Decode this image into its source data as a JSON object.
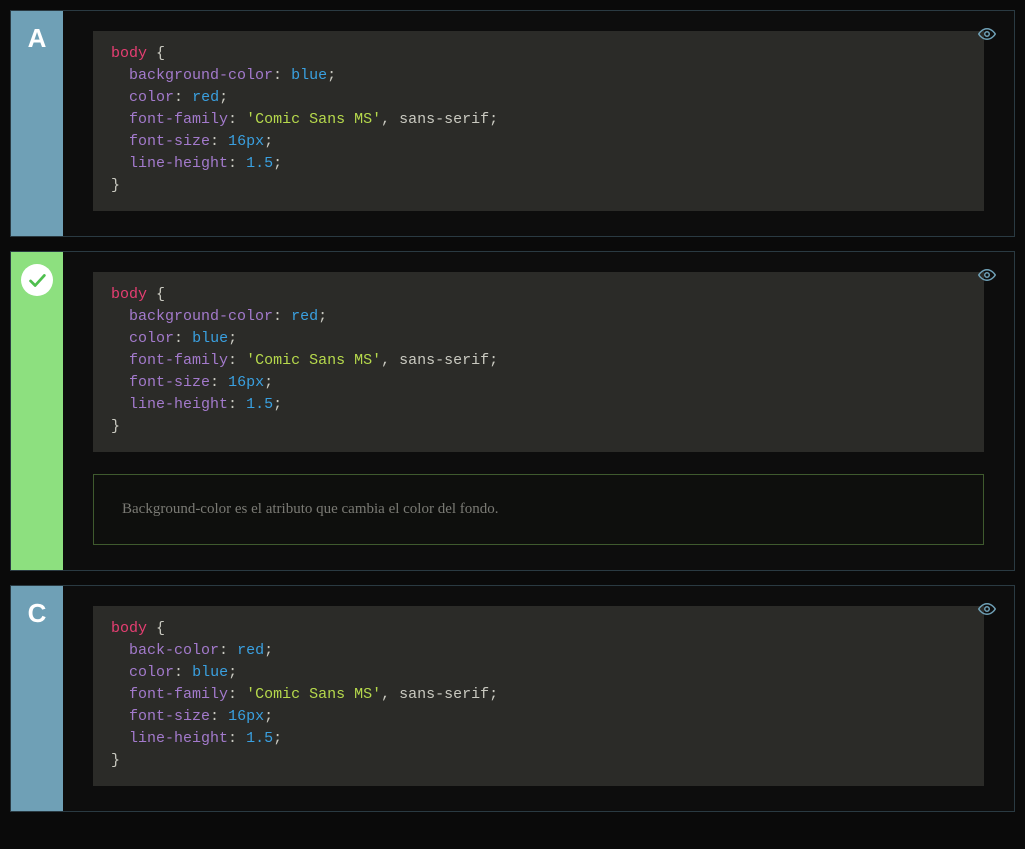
{
  "options": [
    {
      "label": "A",
      "labelClass": "label-blue",
      "correct": false,
      "code": {
        "selector": "body",
        "rules": [
          {
            "prop": "background-color",
            "value_kw": "blue"
          },
          {
            "prop": "color",
            "value_kw": "red"
          },
          {
            "prop": "font-family",
            "value_str": "'Comic Sans MS'",
            "tail_plain": ", sans-serif"
          },
          {
            "prop": "font-size",
            "value_num": "16",
            "unit_kw": "px"
          },
          {
            "prop": "line-height",
            "value_num": "1.5"
          }
        ]
      }
    },
    {
      "label": "",
      "labelClass": "label-green",
      "correct": true,
      "explanation": "Background-color es el atributo que cambia el color del fondo.",
      "code": {
        "selector": "body",
        "rules": [
          {
            "prop": "background-color",
            "value_kw": "red"
          },
          {
            "prop": "color",
            "value_kw": "blue"
          },
          {
            "prop": "font-family",
            "value_str": "'Comic Sans MS'",
            "tail_plain": ", sans-serif"
          },
          {
            "prop": "font-size",
            "value_num": "16",
            "unit_kw": "px"
          },
          {
            "prop": "line-height",
            "value_num": "1.5"
          }
        ]
      }
    },
    {
      "label": "C",
      "labelClass": "label-blue",
      "correct": false,
      "code": {
        "selector": "body",
        "rules": [
          {
            "prop": "back-color",
            "value_kw": "red"
          },
          {
            "prop": "color",
            "value_kw": "blue"
          },
          {
            "prop": "font-family",
            "value_str": "'Comic Sans MS'",
            "tail_plain": ", sans-serif"
          },
          {
            "prop": "font-size",
            "value_num": "16",
            "unit_kw": "px"
          },
          {
            "prop": "line-height",
            "value_num": "1.5"
          }
        ]
      }
    }
  ]
}
